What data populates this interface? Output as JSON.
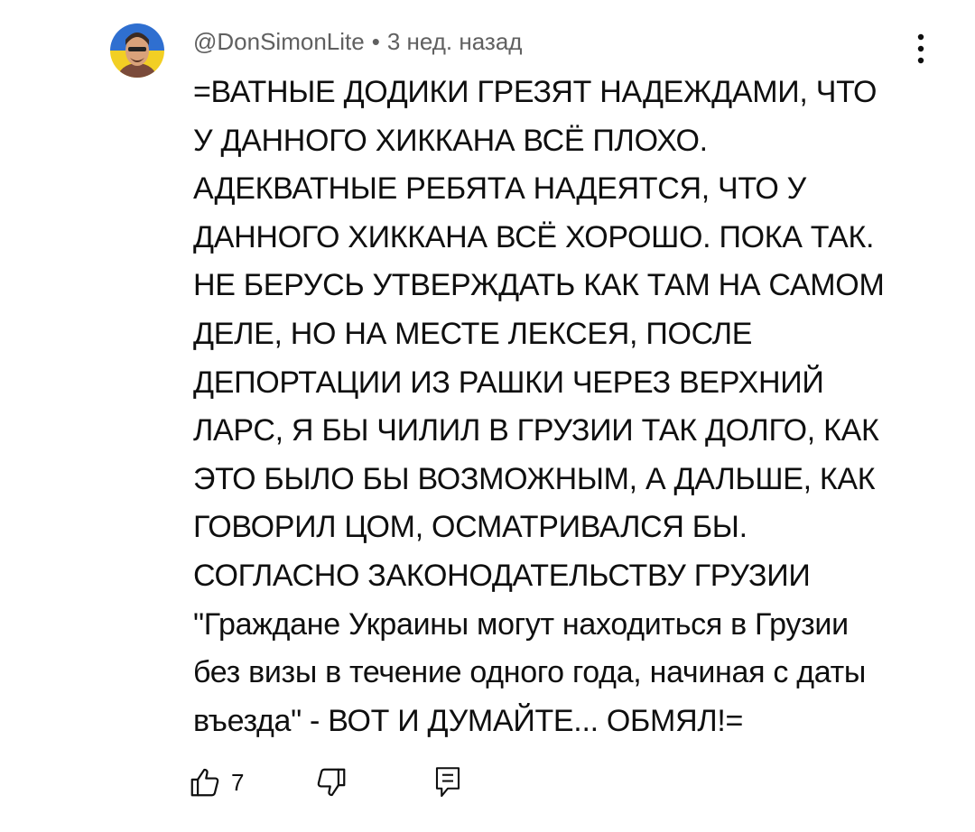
{
  "comment": {
    "author": "@DonSimonLite",
    "separator": "•",
    "time": "3 нед. назад",
    "lines": [
      "=ВАТНЫЕ ДОДИКИ ГРЕЗЯТ НАДЕЖДАМИ, ЧТО",
      "У ДАННОГО ХИККАНА ВСЁ ПЛОХО.",
      "АДЕКВАТНЫЕ РЕБЯТА НАДЕЯТСЯ, ЧТО У",
      "ДАННОГО ХИККАНА ВСЁ ХОРОШО. ПОКА ТАК.",
      "НЕ БЕРУСЬ УТВЕРЖДАТЬ КАК ТАМ НА САМОМ",
      "ДЕЛЕ, НО НА МЕСТЕ ЛЕКСЕЯ, ПОСЛЕ",
      "ДЕПОРТАЦИИ ИЗ РАШКИ ЧЕРЕЗ ВЕРХНИЙ",
      "ЛАРС, Я БЫ ЧИЛИЛ В ГРУЗИИ ТАК ДОЛГО, КАК",
      "ЭТО БЫЛО БЫ ВОЗМОЖНЫМ, А ДАЛЬШЕ, КАК",
      "ГОВОРИЛ ЦОМ, ОСМАТРИВАЛСЯ БЫ.",
      "СОГЛАСНО ЗАКОНОДАТЕЛЬСТВУ ГРУЗИИ",
      "\"Граждане Украины могут находиться в Грузии",
      "без визы в течение одного года, начиная с даты",
      "въезда\" - ВОТ И ДУМАЙТЕ... ОБМЯЛ!="
    ],
    "likes": "7"
  },
  "icons": {
    "avatar": "avatar-image",
    "more": "more-vert-icon",
    "like": "thumb-up-icon",
    "dislike": "thumb-down-icon",
    "reply": "reply-icon"
  },
  "colors": {
    "text": "#0f0f0f",
    "meta": "#606060",
    "avatar_blue": "#2f6fd0",
    "avatar_yellow": "#f2cf24"
  }
}
